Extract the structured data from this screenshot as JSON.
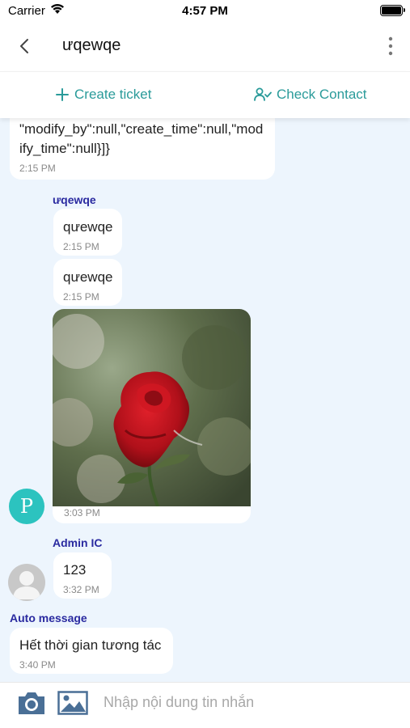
{
  "status_bar": {
    "carrier": "Carrier",
    "time": "4:57 PM"
  },
  "header": {
    "title": "ưqewqe"
  },
  "actions": {
    "create_ticket": "Create ticket",
    "check_contact": "Check Contact"
  },
  "messages": [
    {
      "sender": "",
      "text": "\"modify_by\":null,\"create_time\":null,\"mod\nify_time\":null}]}",
      "time": "2:15 PM"
    },
    {
      "sender": "ưqewqe",
      "text": "qưewqe",
      "time": "2:15 PM"
    },
    {
      "sender": "",
      "text": "qưewqe",
      "time": "2:15 PM"
    },
    {
      "sender": "",
      "type": "image",
      "image": "red-rose-photo",
      "time": "3:03 PM"
    },
    {
      "sender": "Admin IC",
      "text": "123",
      "time": "3:32 PM"
    },
    {
      "sender": "Auto message",
      "text": "Hết thời gian tương tác",
      "time": "3:40 PM"
    }
  ],
  "avatars": {
    "customer_initial": "P"
  },
  "composer": {
    "placeholder": "Nhập nội dung tin nhắn"
  },
  "colors": {
    "accent": "#2a9b9a",
    "sender_name": "#2a2aa0",
    "chat_bg": "#edf5fd",
    "avatar": "#2cc3bf"
  }
}
